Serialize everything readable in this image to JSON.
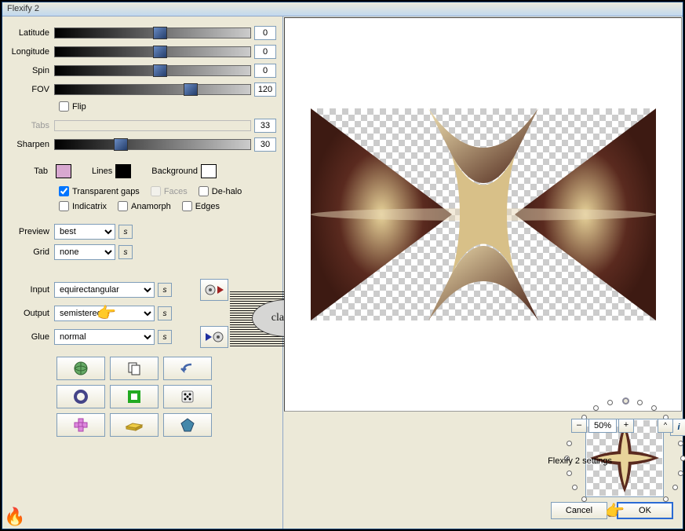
{
  "window": {
    "title": "Flexify 2"
  },
  "sliders": {
    "latitude": {
      "label": "Latitude",
      "value": "0",
      "pos": 50
    },
    "longitude": {
      "label": "Longitude",
      "value": "0",
      "pos": 50
    },
    "spin": {
      "label": "Spin",
      "value": "0",
      "pos": 50
    },
    "fov": {
      "label": "FOV",
      "value": "120",
      "pos": 66
    },
    "tabs": {
      "label": "Tabs",
      "value": "33",
      "pos": 0,
      "disabled": true
    },
    "sharpen": {
      "label": "Sharpen",
      "value": "30",
      "pos": 30
    }
  },
  "flip": {
    "label": "Flip",
    "checked": false
  },
  "colors": {
    "tab": {
      "label": "Tab",
      "hex": "#d8a8d0"
    },
    "lines": {
      "label": "Lines",
      "hex": "#000000"
    },
    "background": {
      "label": "Background",
      "hex": "#ffffff"
    }
  },
  "checks": {
    "transparent_gaps": {
      "label": "Transparent gaps",
      "checked": true
    },
    "faces": {
      "label": "Faces",
      "checked": false,
      "disabled": true
    },
    "dehalo": {
      "label": "De-halo",
      "checked": false
    },
    "indicatrix": {
      "label": "Indicatrix",
      "checked": false
    },
    "anamorph": {
      "label": "Anamorph",
      "checked": false
    },
    "edges": {
      "label": "Edges",
      "checked": false
    }
  },
  "selects": {
    "preview": {
      "label": "Preview",
      "value": "best"
    },
    "grid": {
      "label": "Grid",
      "value": "none"
    },
    "input": {
      "label": "Input",
      "value": "equirectangular"
    },
    "output": {
      "label": "Output",
      "value": "semistereo"
    },
    "glue": {
      "label": "Glue",
      "value": "normal"
    }
  },
  "s_btn": "s",
  "bottom": {
    "zoom_minus": "–",
    "zoom_value": "50%",
    "zoom_plus": "+",
    "corner": "^",
    "settings_label": "Flexify 2 settings",
    "cancel": "Cancel",
    "ok": "OK",
    "info": "i"
  },
  "watermark": "claudia",
  "icon_buttons": [
    "rotate-globe",
    "copy",
    "undo",
    "circle",
    "square",
    "dice",
    "plus-grid",
    "brick",
    "polygon"
  ]
}
